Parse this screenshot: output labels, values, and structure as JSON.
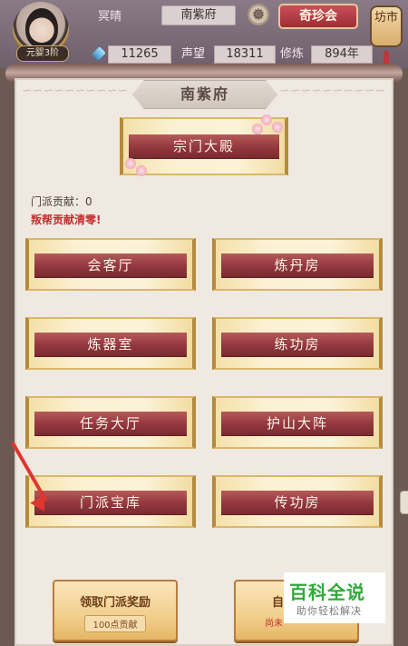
{
  "header": {
    "rank_badge": "元婴3阶",
    "player_name": "冥晴",
    "sect_name": "南紫府",
    "qizhenhui_button": "奇珍会",
    "market_lantern": "坊市",
    "jade_value": "11265",
    "reputation_label": "声望",
    "reputation_value": "18311",
    "cultivation_label": "修炼",
    "cultivation_value": "894年"
  },
  "panel": {
    "title": "南紫府",
    "main_hall": "宗门大殿",
    "contribution_label": "门派贡献：0",
    "warning": "叛帮贡献清零!",
    "buildings": [
      "会客厅",
      "炼丹房",
      "炼器室",
      "练功房",
      "任务大厅",
      "护山大阵",
      "门派宝库",
      "传功房"
    ]
  },
  "bottom": {
    "claim_reward_label": "领取门派奖励",
    "claim_reward_cost": "100点贡献",
    "right_button_label": "自",
    "right_button_sub": "尚未"
  },
  "watermark": {
    "title": "百科全说",
    "subtitle": "助你轻松解决"
  },
  "colors": {
    "ribbon": "#92373d",
    "warning": "#c62f2f",
    "arrow": "#e0362f"
  }
}
